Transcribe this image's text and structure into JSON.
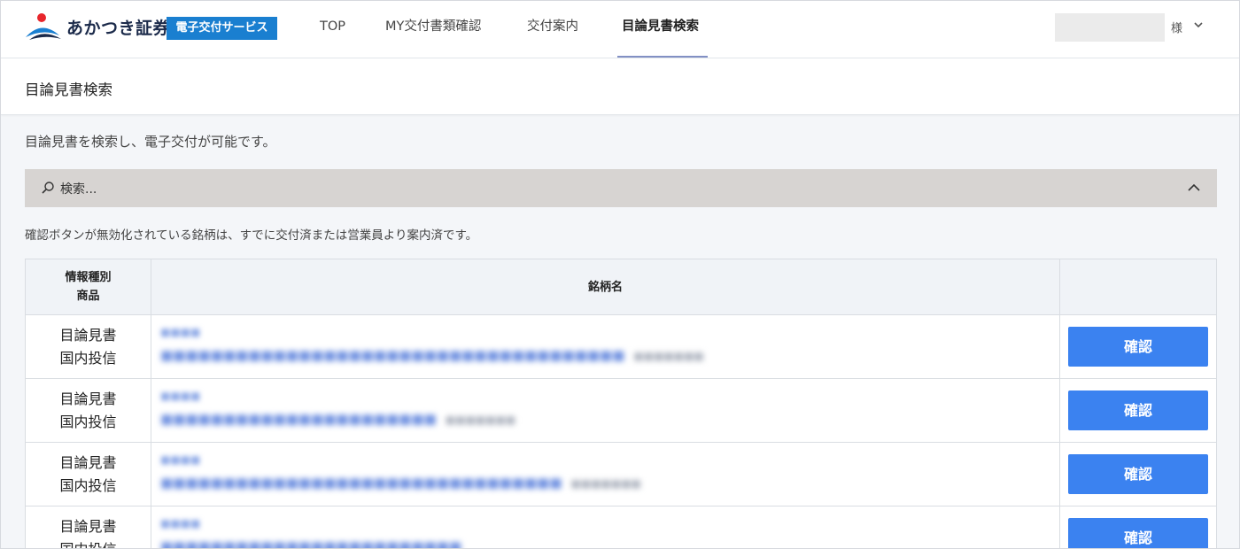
{
  "header": {
    "brand": "あかつき証券",
    "service_badge": "電子交付サービス",
    "nav": [
      {
        "label": "TOP"
      },
      {
        "label": "MY交付書類確認"
      },
      {
        "label": "交付案内"
      },
      {
        "label": "目論見書検索"
      }
    ],
    "user_suffix": "様",
    "colors": {
      "brand_red": "#e8262c",
      "brand_navy": "#1b2a4a",
      "badge_blue": "#1a7fd0",
      "active_underline": "#8290c4"
    }
  },
  "page": {
    "title": "目論見書検索",
    "description": "目論見書を検索し、電子交付が可能です。",
    "search_label": "検索...",
    "notice": "確認ボタンが無効化されている銘柄は、すでに交付済または営業員より案内済です。"
  },
  "table": {
    "header_type_line1": "情報種別",
    "header_type_line2": "商品",
    "header_name": "銘柄名",
    "rows": [
      {
        "type1": "目論見書",
        "type2": "国内投信",
        "button": "確認"
      },
      {
        "type1": "目論見書",
        "type2": "国内投信",
        "button": "確認"
      },
      {
        "type1": "目論見書",
        "type2": "国内投信",
        "button": "確認"
      },
      {
        "type1": "目論見書",
        "type2": "国内投信",
        "button": "確認"
      }
    ],
    "accent_color": "#3b82f0"
  }
}
